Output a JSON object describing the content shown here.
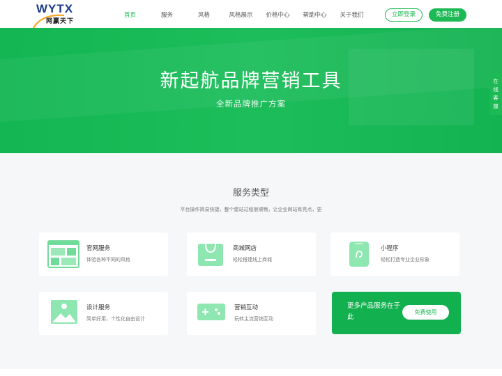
{
  "brand": {
    "logo_text": "WYTX",
    "logo_sub": "网赢天下"
  },
  "nav": {
    "items": [
      {
        "label": "首页",
        "active": true
      },
      {
        "label": "服务"
      },
      {
        "label": "风格"
      },
      {
        "label": "风格展示"
      },
      {
        "label": "价格中心"
      },
      {
        "label": "帮助中心"
      },
      {
        "label": "关于我们"
      }
    ],
    "login": "立即登录",
    "register": "免费注册"
  },
  "hero": {
    "title": "新起航品牌营销工具",
    "subtitle": "全新品牌推广方案"
  },
  "side_service": "在线客服",
  "services": {
    "title": "服务类型",
    "description": "平台操作简易快捷，整个建站过程很顺畅，让企业网站有亮点，更",
    "items": [
      {
        "name": "官网服务",
        "desc": "体验各种不同的风格",
        "icon": "website-layout-icon"
      },
      {
        "name": "商城网店",
        "desc": "轻松搭建线上商城",
        "icon": "shopping-bag-icon"
      },
      {
        "name": "小程序",
        "desc": "轻松打造专业企业形象",
        "icon": "mini-program-icon"
      },
      {
        "name": "设计服务",
        "desc": "简单好用，个性化自由设计",
        "icon": "image-design-icon"
      },
      {
        "name": "营销互动",
        "desc": "玩转主流营销互动",
        "icon": "gamepad-icon"
      }
    ],
    "promo": {
      "text": "更多产品服务在于此",
      "button": "免费使用"
    }
  },
  "colors": {
    "brand_green": "#1db954",
    "logo_blue": "#1e3a8a",
    "icon_green": "#7fe0a5"
  }
}
